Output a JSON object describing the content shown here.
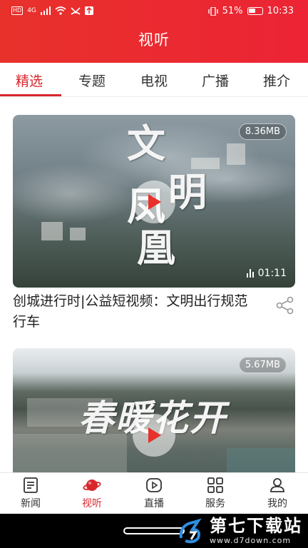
{
  "status_bar": {
    "left_text": [
      "HD",
      "4G"
    ],
    "battery": "51%",
    "time": "10:33"
  },
  "header": {
    "title": "视听"
  },
  "tabs": [
    {
      "label": "精选",
      "active": true
    },
    {
      "label": "专题",
      "active": false
    },
    {
      "label": "电视",
      "active": false
    },
    {
      "label": "广播",
      "active": false
    },
    {
      "label": "推介",
      "active": false
    }
  ],
  "feed": [
    {
      "overlay_text": [
        "文",
        "明",
        "凤",
        "凰"
      ],
      "size": "8.36MB",
      "duration": "01:11",
      "title": "创城进行时|公益短视频：文明出行规范行车"
    },
    {
      "overlay_text": "春暖花开",
      "size": "5.67MB"
    }
  ],
  "bottom_nav": [
    {
      "label": "新闻",
      "icon": "news-icon",
      "active": false
    },
    {
      "label": "视听",
      "icon": "planet-icon",
      "active": true
    },
    {
      "label": "直播",
      "icon": "live-play-icon",
      "active": false
    },
    {
      "label": "服务",
      "icon": "grid-icon",
      "active": false
    },
    {
      "label": "我的",
      "icon": "user-icon",
      "active": false
    }
  ],
  "watermark": {
    "title": "第七下载站",
    "url": "www.d7down.com"
  },
  "colors": {
    "accent": "#d8262c",
    "header": "#e8312b"
  }
}
